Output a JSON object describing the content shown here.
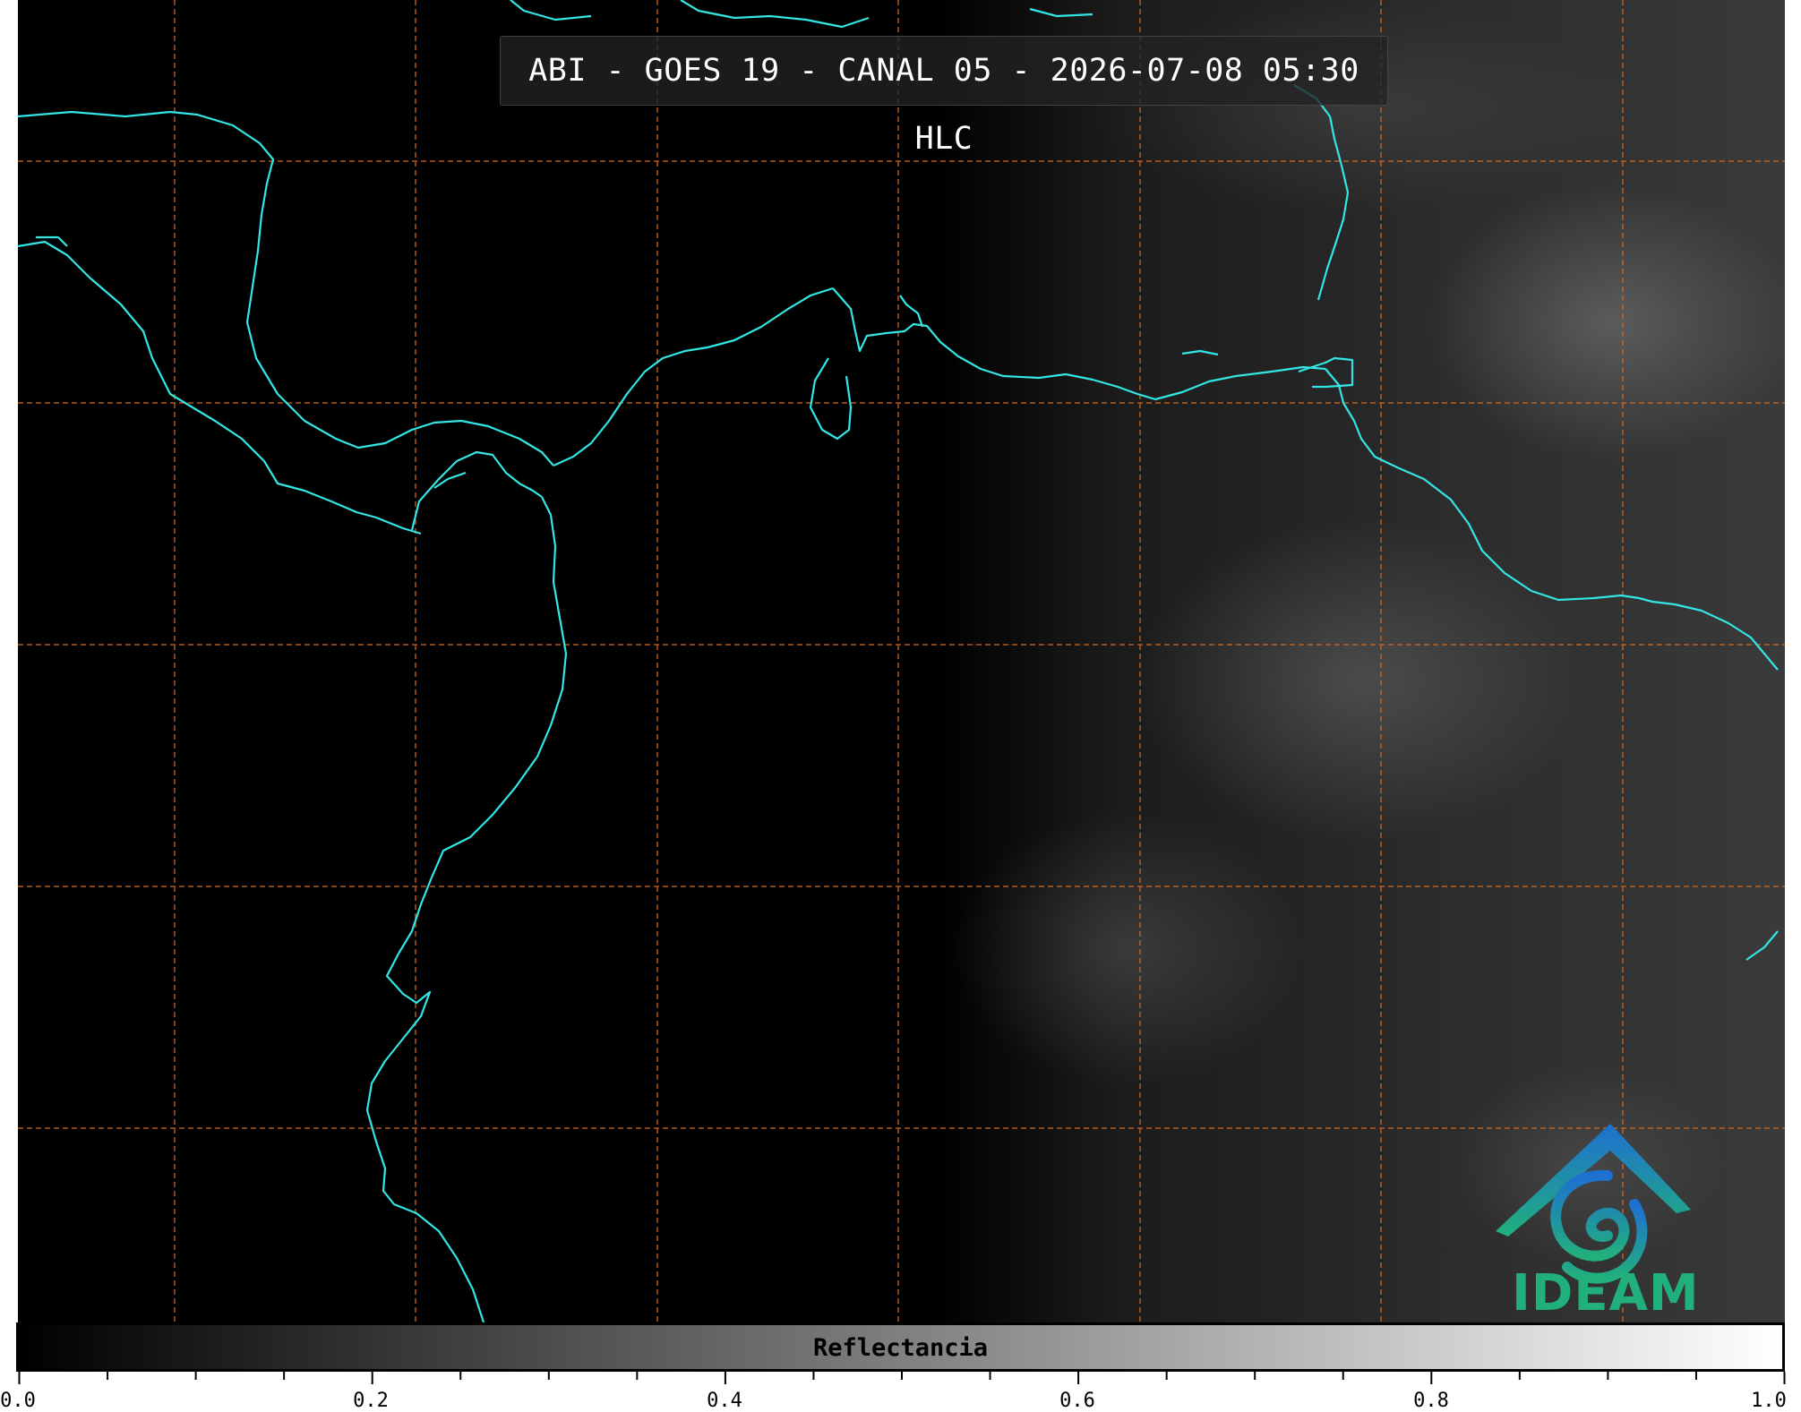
{
  "title": "ABI - GOES 19 - CANAL 05 - 2026-07-08 05:30 HLC",
  "logo_text": "IDEAM",
  "colors": {
    "coastline": "#33e6e6",
    "gridline": "#d2691e",
    "logo_green": "#21b07c",
    "logo_blue": "#1f6fd1"
  },
  "colorbar": {
    "label": "Reflectancia",
    "range": [
      0.0,
      1.0
    ],
    "colormap": "grayscale",
    "tick_labels": [
      "0.0",
      "0.2",
      "0.4",
      "0.6",
      "0.8",
      "1.0"
    ]
  },
  "map": {
    "gridlines": "dashed",
    "features": [
      "coastline-icon",
      "land-boundaries"
    ]
  }
}
